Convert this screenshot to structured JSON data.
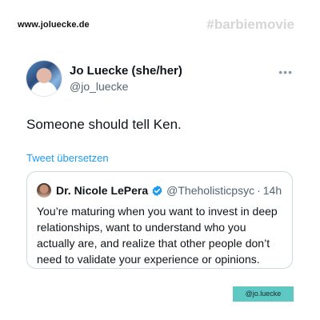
{
  "header": {
    "site_url": "www.joluecke.de",
    "hashtag": "#barbiemovie"
  },
  "tweet": {
    "display_name": "Jo Luecke (she/her)",
    "handle": "@jo_luecke",
    "more_icon": "more-horizontal-icon",
    "text": "Someone should tell Ken.",
    "translate_label": "Tweet übersetzen"
  },
  "quote": {
    "display_name": "Dr. Nicole LePera",
    "verified_icon": "verified-badge-icon",
    "handle": "@Theholisticpsyc",
    "separator": "·",
    "time": "14h",
    "text": "You’re maturing when you want to invest in deep relationships, want to understand who you actually are, and realize that other people don’t need to validate your experience or opinions."
  },
  "footer": {
    "author_badge": "@jo.luecke"
  },
  "colors": {
    "link": "#1d9bf0",
    "badge_bg": "#5ec8c3",
    "hashtag": "#d6d6d6"
  }
}
